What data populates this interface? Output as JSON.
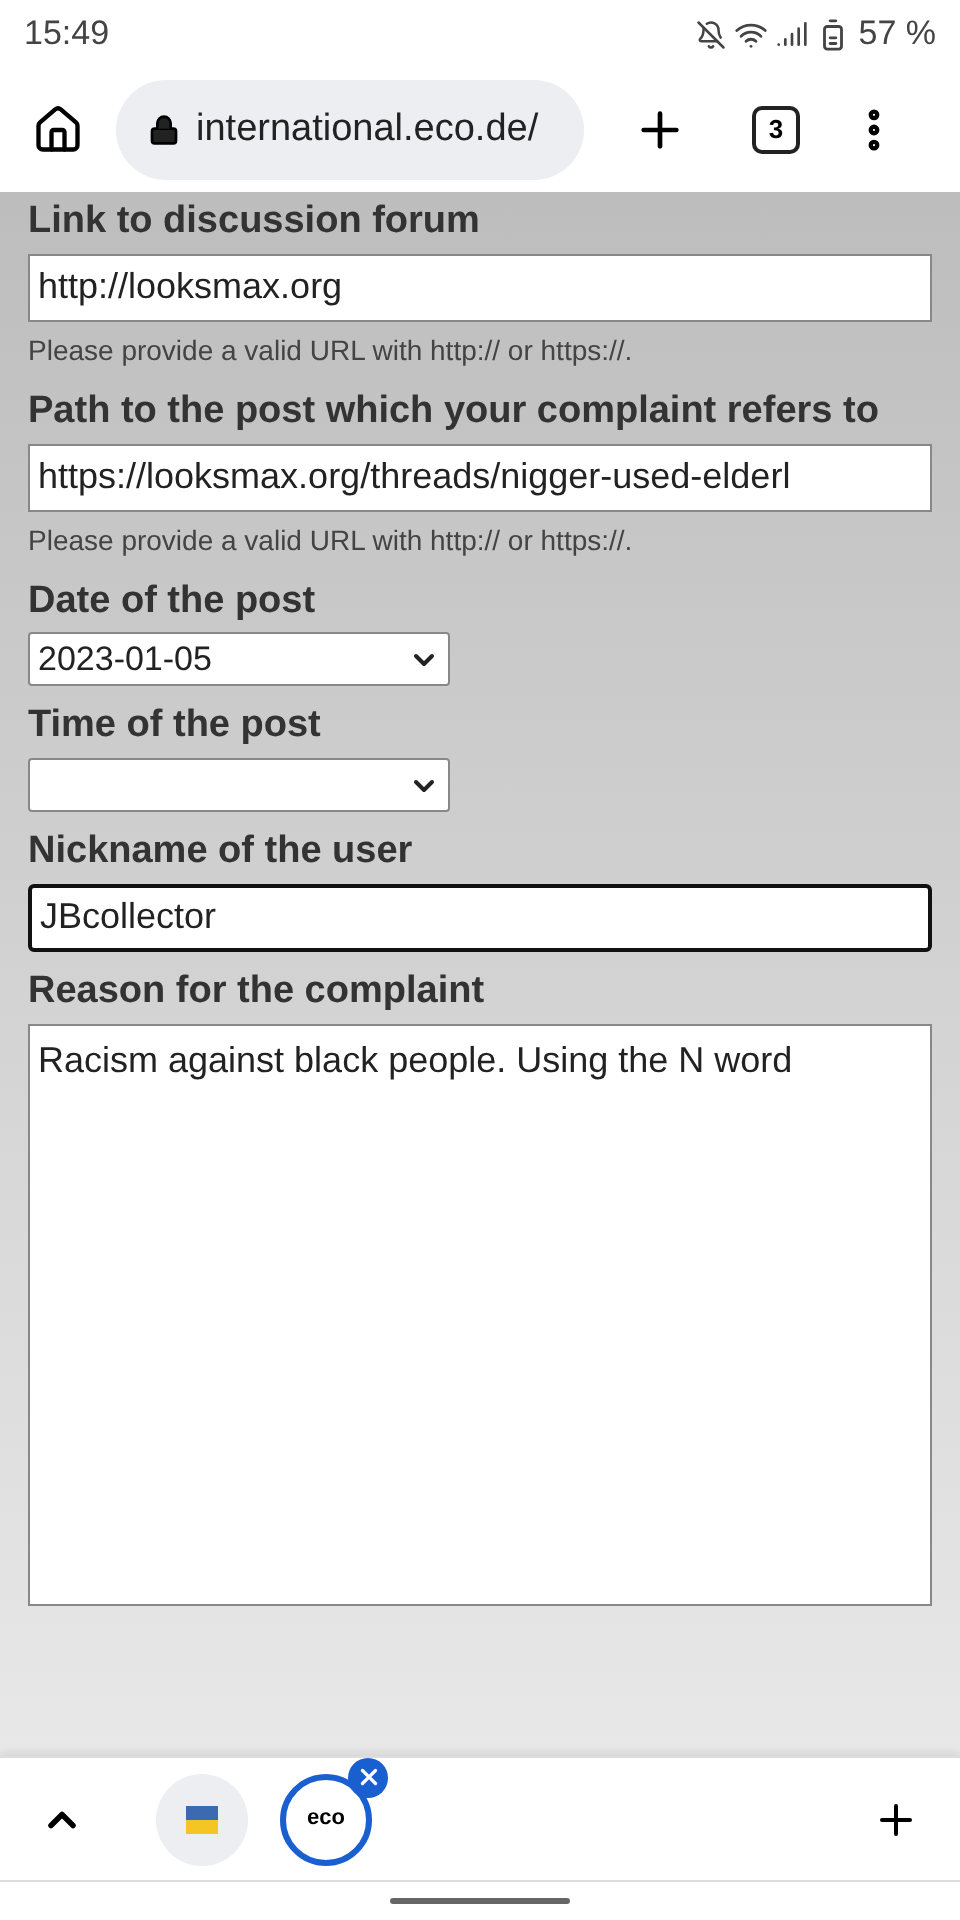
{
  "status_bar": {
    "time": "15:49",
    "battery": "57 %"
  },
  "toolbar": {
    "url": "international.eco.de/",
    "tab_count": "3"
  },
  "fields": [
    {
      "kind": "input",
      "label": "Link to discussion forum",
      "value": "http://looksmax.org",
      "help": "Please provide a valid URL with http:// or https://.",
      "focused": false
    },
    {
      "kind": "input",
      "label": "Path to the post which your complaint refers to",
      "value": "https://looksmax.org/threads/nigger-used-elderl",
      "help": "Please provide a valid URL with http:// or https://.",
      "focused": false
    },
    {
      "kind": "select",
      "label": "Date of the post",
      "value": "2023-01-05"
    },
    {
      "kind": "select",
      "label": "Time of the post"
    },
    {
      "kind": "input",
      "label": "Nickname of the user",
      "value": "JBcollector",
      "focused": true
    },
    {
      "kind": "textarea",
      "label": "Reason for the complaint",
      "value": "Racism against black people. Using the N word"
    }
  ],
  "tab_strip": {
    "tabs": [
      {
        "kind": "flag",
        "selected": false
      },
      {
        "kind": "logo",
        "logo_text": "eco",
        "selected": true
      }
    ]
  }
}
